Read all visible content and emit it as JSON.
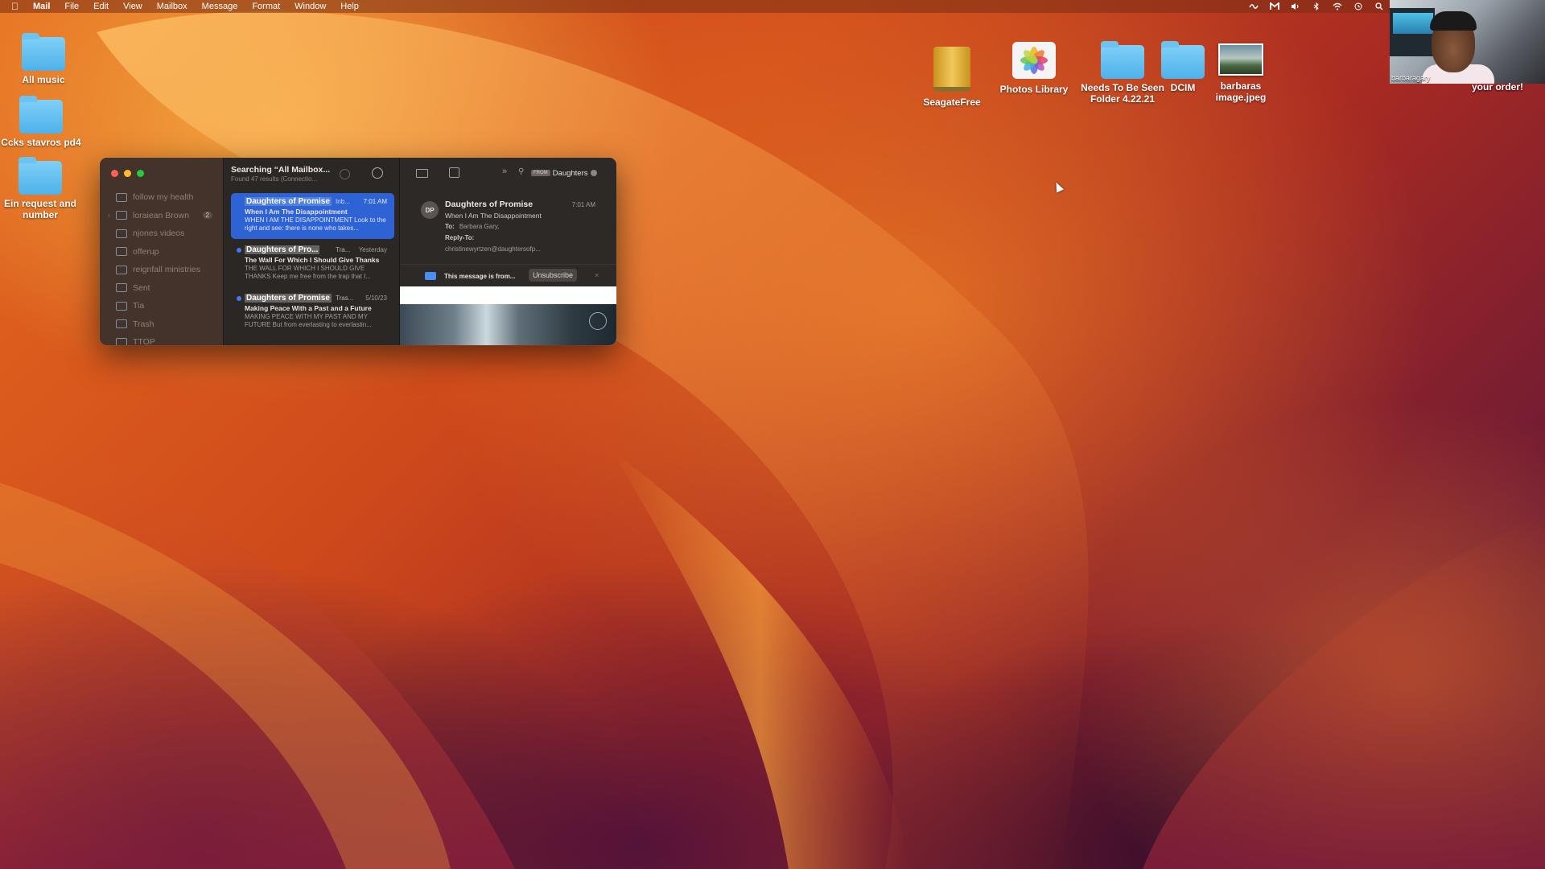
{
  "menubar": {
    "app": "Mail",
    "items": [
      "File",
      "Edit",
      "View",
      "Mailbox",
      "Message",
      "Format",
      "Window",
      "Help"
    ]
  },
  "desktop": {
    "left_icons": [
      {
        "label": "All music",
        "icon": "folder-icon"
      },
      {
        "label": "Ccks stavros pd4",
        "icon": "folder-icon"
      },
      {
        "label": "Ein request and number",
        "icon": "folder-icon"
      }
    ],
    "top_icons": [
      {
        "label": "SeagateFree",
        "icon": "external-drive-icon"
      },
      {
        "label": "Photos Library",
        "icon": "photos-icon"
      },
      {
        "label": "Needs To Be Seen Folder 4.22.21",
        "icon": "folder-icon"
      },
      {
        "label": "DCIM",
        "icon": "folder-icon"
      },
      {
        "label": "barbaras image.jpeg",
        "icon": "image-thumbnail-icon"
      }
    ]
  },
  "webcam": {
    "name": "barbaragary",
    "caption": "your order!"
  },
  "mail": {
    "sidebar": {
      "folders": [
        {
          "label": "follow my health",
          "badge": ""
        },
        {
          "label": "loraiean Brown",
          "badge": "2",
          "expandable": true
        },
        {
          "label": "njones videos",
          "badge": ""
        },
        {
          "label": "offerup",
          "badge": ""
        },
        {
          "label": "reignfall ministries",
          "badge": ""
        },
        {
          "label": "Sent",
          "badge": ""
        },
        {
          "label": "Tia",
          "badge": ""
        },
        {
          "label": "Trash",
          "badge": ""
        },
        {
          "label": "TTOP",
          "badge": ""
        }
      ]
    },
    "list": {
      "title": "Searching “All Mailbox...",
      "subtitle": "Found 47 results (Connectio...",
      "messages": [
        {
          "from": "Daughters of Promise",
          "mailbox": "Inb...",
          "time": "7:01 AM",
          "subject": "When I Am The Disappointment",
          "preview": "WHEN I AM THE DISAPPOINTMENT Look to the right and see: there is none who takes...",
          "selected": true,
          "unread": false
        },
        {
          "from": "Daughters of Pro...",
          "mailbox": "Tra...",
          "time": "Yesterday",
          "subject": "The Wall For Which I Should Give Thanks",
          "preview": "THE WALL FOR WHICH I SHOULD GIVE THANKS Keep me free from the trap that I...",
          "selected": false,
          "unread": true
        },
        {
          "from": "Daughters of Promise",
          "mailbox": "Tras...",
          "time": "5/10/23",
          "subject": "Making Peace With a Past and a Future",
          "preview": "MAKING PEACE WITH MY PAST AND MY FUTURE But from everlasting to everlastin...",
          "selected": false,
          "unread": true
        }
      ]
    },
    "reader": {
      "search_token": "FROM",
      "search_query": "Daughters",
      "avatar_initials": "DP",
      "from": "Daughters of Promise",
      "time": "7:01 AM",
      "subject": "When I Am The Disappointment",
      "to_label": "To:",
      "to": "Barbara Gary,",
      "reply_to_label": "Reply-To:",
      "reply_to": "christinewyrtzen@daughtersofp...",
      "banner_text": "This message is from...",
      "unsubscribe": "Unsubscribe",
      "close_glyph": "×"
    }
  },
  "colors": {
    "selection": "#2e63d6",
    "folder": "#4fb1ea"
  }
}
